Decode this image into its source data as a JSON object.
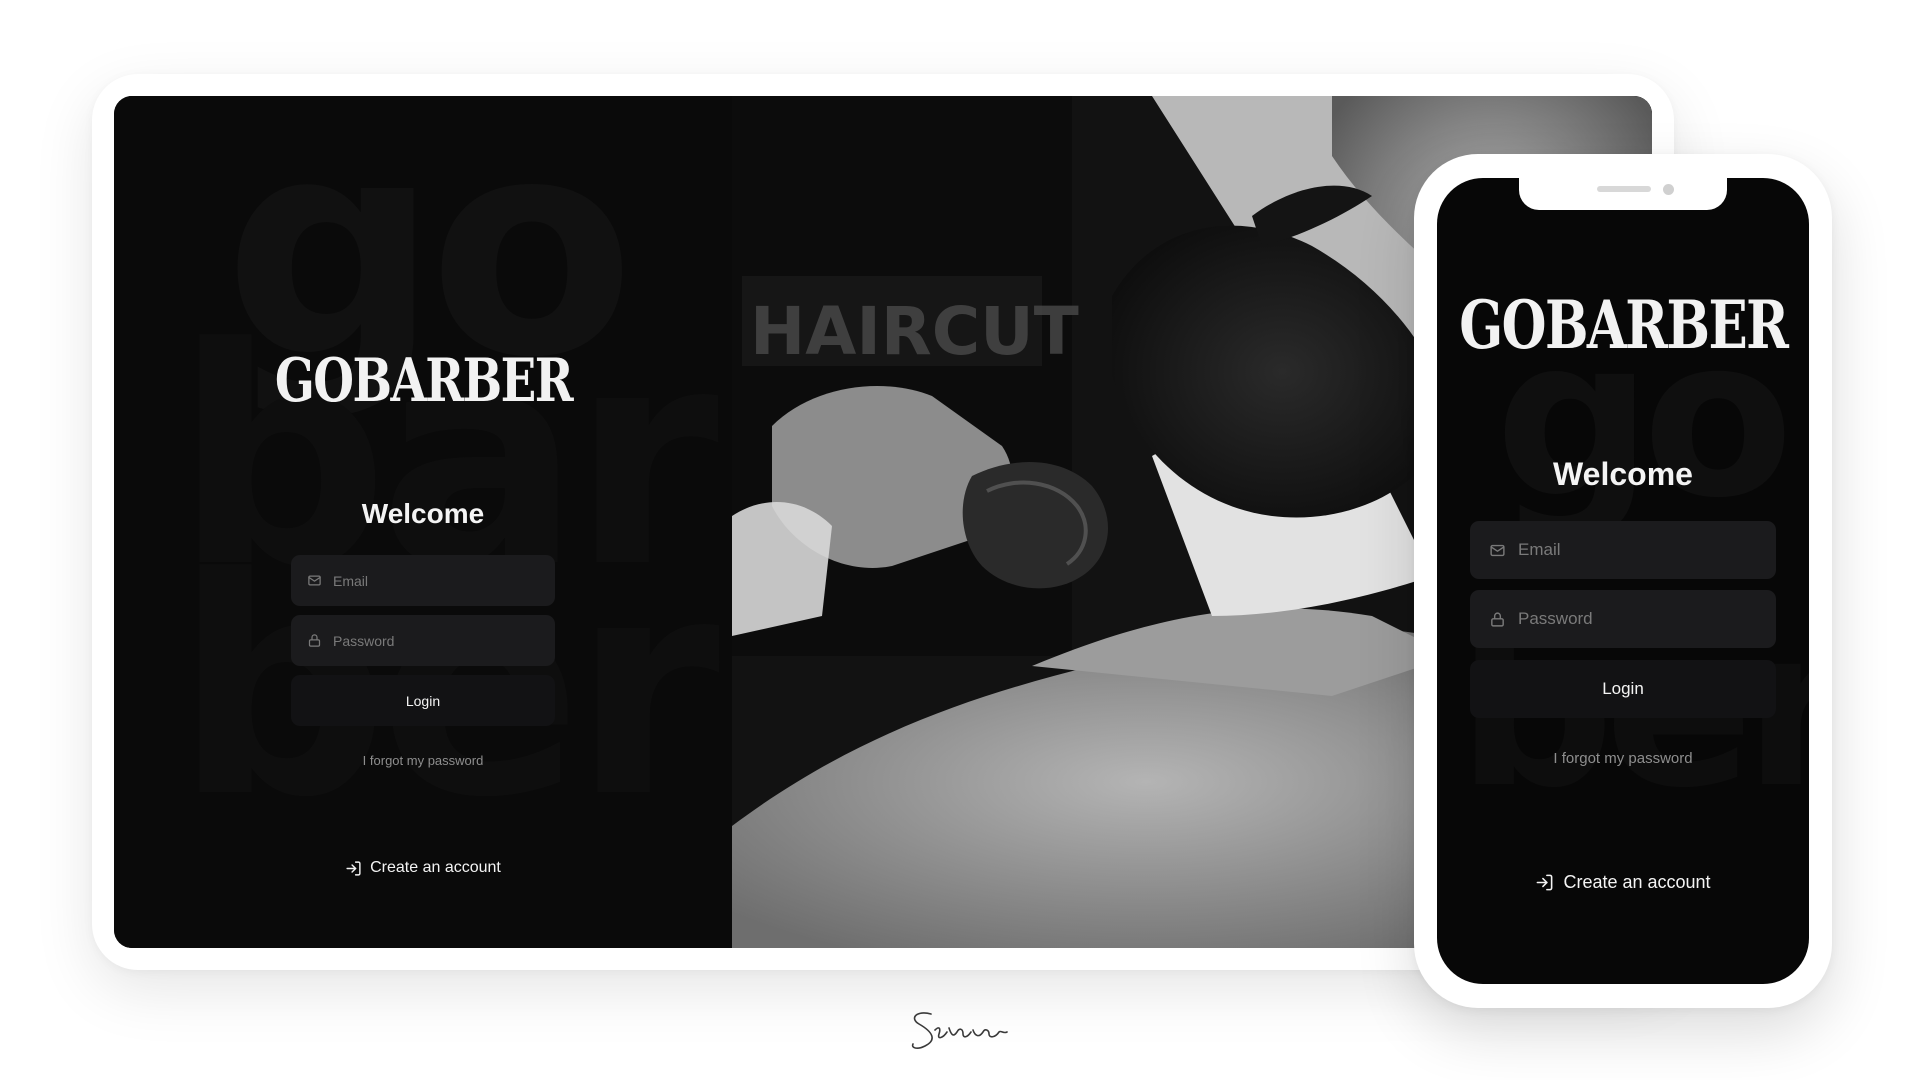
{
  "brand": {
    "name": "GOBARBER"
  },
  "login": {
    "title": "Welcome",
    "email_placeholder": "Email",
    "password_placeholder": "Password",
    "login_label": "Login",
    "forgot_label": "I forgot my password",
    "create_account_label": "Create an account"
  },
  "photo": {
    "sign_text": "HAIRCUT"
  },
  "icons": {
    "email": "mail-icon",
    "password": "lock-icon",
    "create_account": "log-in-icon"
  },
  "colors": {
    "background": "#0a0a0a",
    "input_bg": "#1b1b1d",
    "text": "#f4f4f4",
    "muted_text": "#8e8e8e",
    "page": "#ffffff"
  }
}
